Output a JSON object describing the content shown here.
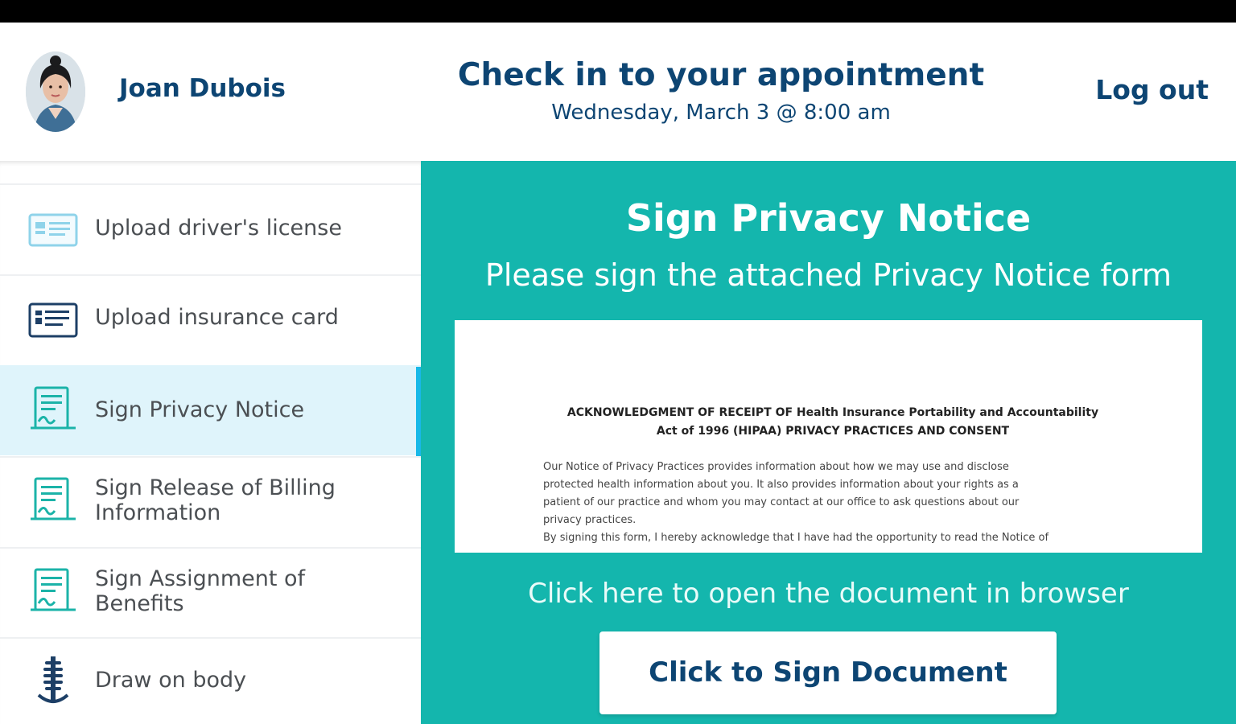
{
  "header": {
    "user_name": "Joan Dubois",
    "title": "Check in to your appointment",
    "subtitle": "Wednesday, March 3 @ 8:00 am",
    "logout_label": "Log out"
  },
  "sidebar": {
    "items": [
      {
        "label": "Upload driver's license",
        "icon": "id-card-icon"
      },
      {
        "label": "Upload insurance card",
        "icon": "insurance-card-icon"
      },
      {
        "label": "Sign Privacy Notice",
        "icon": "sign-document-icon",
        "active": true
      },
      {
        "label": "Sign Release of Billing Information",
        "icon": "sign-document-icon"
      },
      {
        "label": "Sign Assignment of Benefits",
        "icon": "sign-document-icon"
      },
      {
        "label": "Draw on body",
        "icon": "spine-icon"
      }
    ]
  },
  "main": {
    "title": "Sign Privacy Notice",
    "subtitle": "Please sign the attached Privacy Notice form",
    "document": {
      "heading_line1": "ACKNOWLEDGMENT OF RECEIPT OF Health Insurance Portability and Accountability",
      "heading_line2": "Act of 1996 (HIPAA) PRIVACY PRACTICES AND CONSENT",
      "body_lines": [
        "Our Notice of Privacy Practices provides information about how we may use and disclose",
        "protected health information about you. It also provides information about your rights as a",
        "patient of our practice and whom you may contact at our office to ask questions about our",
        "privacy practices.",
        "By signing this form, I hereby acknowledge that I have had the opportunity to read the Notice of"
      ]
    },
    "open_link": "Click here to open the document in browser",
    "sign_button": "Click to Sign Document"
  },
  "colors": {
    "brand_navy": "#0d4573",
    "panel_teal": "#14b6ad",
    "active_item_bg": "#dff4fb",
    "active_indicator": "#18b8e8"
  }
}
